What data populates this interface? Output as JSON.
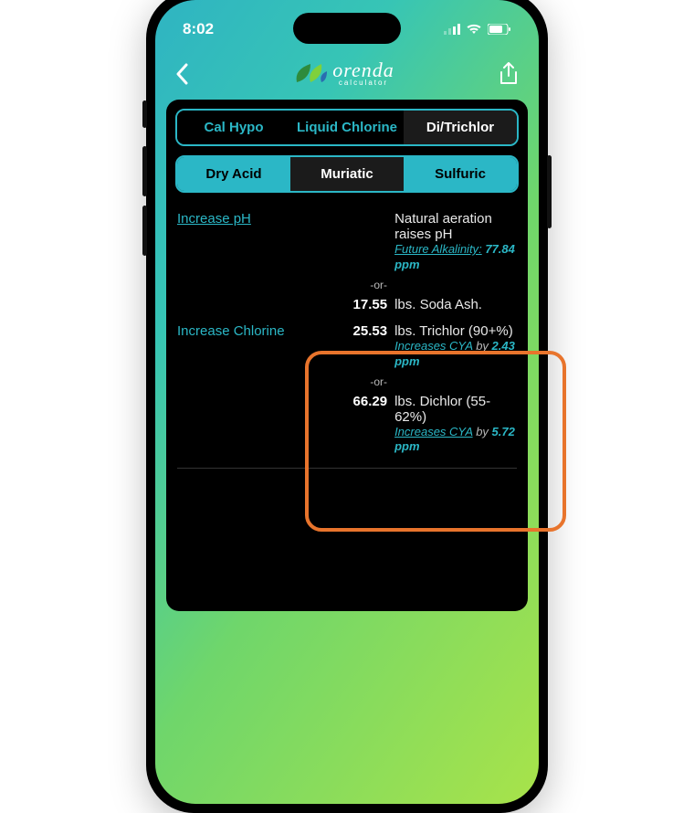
{
  "status": {
    "time": "8:02"
  },
  "header": {
    "brand": "orenda",
    "sub": "calculator"
  },
  "seg1": {
    "items": [
      {
        "label": "Cal Hypo",
        "state": "plain"
      },
      {
        "label": "Liquid Chlorine",
        "state": "plain"
      },
      {
        "label": "Di/Trichlor",
        "state": "darkActive"
      }
    ]
  },
  "seg2": {
    "items": [
      {
        "label": "Dry Acid",
        "state": "active"
      },
      {
        "label": "Muriatic",
        "state": "darkActive"
      },
      {
        "label": "Sulfuric",
        "state": "active"
      }
    ]
  },
  "ph": {
    "linkLabel": "Increase pH",
    "desc1": "Natural aeration raises pH",
    "futureAlkLabel": "Future Alkalinity",
    "futureAlkValue": "77.84 ppm",
    "or": "-or-",
    "sodaAshAmount": "17.55",
    "sodaAshDesc": "lbs. Soda Ash."
  },
  "chlorine": {
    "label": "Increase Chlorine",
    "trichlorAmount": "25.53",
    "trichlorDesc": "lbs. Trichlor (90+%)",
    "trichlorNoteLink": "Increases CYA",
    "trichlorNoteMid": " by ",
    "trichlorNoteVal": "2.43 ppm",
    "or": "-or-",
    "dichlorAmount": "66.29",
    "dichlorDesc": "lbs. Dichlor (55-62%)",
    "dichlorNoteLink": "Increases CYA",
    "dichlorNoteMid": " by ",
    "dichlorNoteVal": "5.72 ppm"
  }
}
